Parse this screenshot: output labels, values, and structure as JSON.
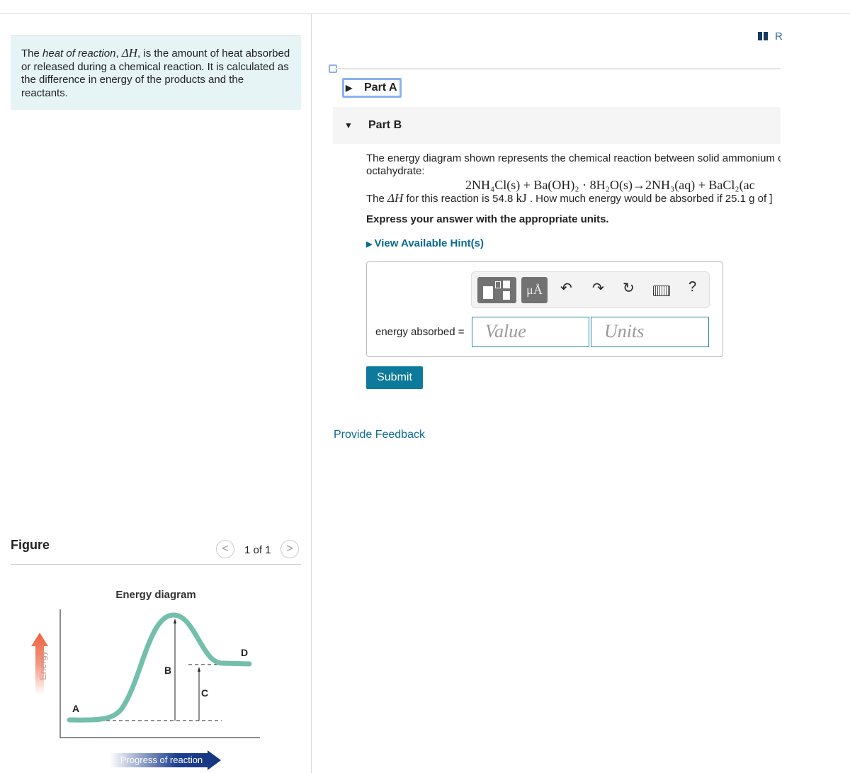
{
  "intro": {
    "pre": "The ",
    "term": "heat of reaction",
    "mid": ", ",
    "sym": "ΔH",
    "post": ", is the amount of heat absorbed or released during a chemical reaction. It is calculated as the difference in energy of the products and the reactants."
  },
  "figure": {
    "title": "Figure",
    "pager": "1 of 1",
    "prev": "<",
    "next": ">",
    "diagram": {
      "title": "Energy diagram",
      "y_label": "Energy",
      "x_label": "Progress of reaction",
      "labels": [
        "A",
        "B",
        "C",
        "D"
      ],
      "curve_color": "#74bfab"
    }
  },
  "header": {
    "resource_label": "R"
  },
  "parts": {
    "a": "Part A",
    "b": "Part B"
  },
  "question": {
    "line1": "The energy diagram shown represents the chemical reaction between solid ammonium c",
    "line2": "octahydrate:",
    "equation": "2NH₄Cl(s) + Ba(OH)₂ · 8H₂O(s)→2NH₃(aq) + BaCl₂(ac",
    "dh_pre": "The ",
    "dh_sym": "ΔH",
    "dh_mid": " for this reaction is 54.8 ",
    "dh_unit": "kJ",
    "dh_post": " . How much energy would be absorbed if 25.1 g of ]",
    "instruction": "Express your answer with the appropriate units.",
    "hint": "View Available Hint(s)"
  },
  "answer": {
    "label": "energy absorbed =",
    "value_placeholder": "Value",
    "units_placeholder": "Units",
    "units_btn": "μÅ",
    "help": "?"
  },
  "submit": "Submit",
  "feedback": "Provide Feedback",
  "colors": {
    "accent": "#0e7a9b",
    "link": "#0b6a8e",
    "info_bg": "#e6f4f6"
  }
}
